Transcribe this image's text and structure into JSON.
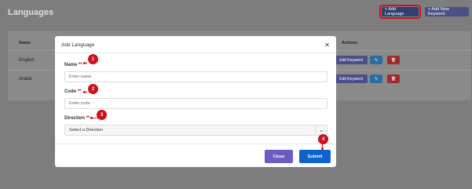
{
  "page": {
    "title": "Languages"
  },
  "header": {
    "add_language": "+ Add Language",
    "add_keyword": "+ Add New Keyword"
  },
  "table": {
    "headers": [
      "Name",
      "Actions"
    ],
    "rows": [
      {
        "name": "English",
        "edit": "Edit Keyword"
      },
      {
        "name": "Arabic",
        "edit": "Edit Keyword"
      }
    ]
  },
  "modal": {
    "title": "Add Language",
    "fields": {
      "name": {
        "label": "Name",
        "required": "**",
        "placeholder": "Enter name"
      },
      "code": {
        "label": "Code",
        "required": "**",
        "placeholder": "Enter code"
      },
      "direction": {
        "label": "Direction",
        "required": "**",
        "value": "Select a Direction"
      }
    },
    "close_label": "Close",
    "submit_label": "Submit"
  },
  "annotations": {
    "one": "1",
    "two": "2",
    "three": "3",
    "four": "4"
  },
  "colors": {
    "marker": "#d0101a",
    "submit": "#0d63ce",
    "close": "#6a5cc0"
  }
}
